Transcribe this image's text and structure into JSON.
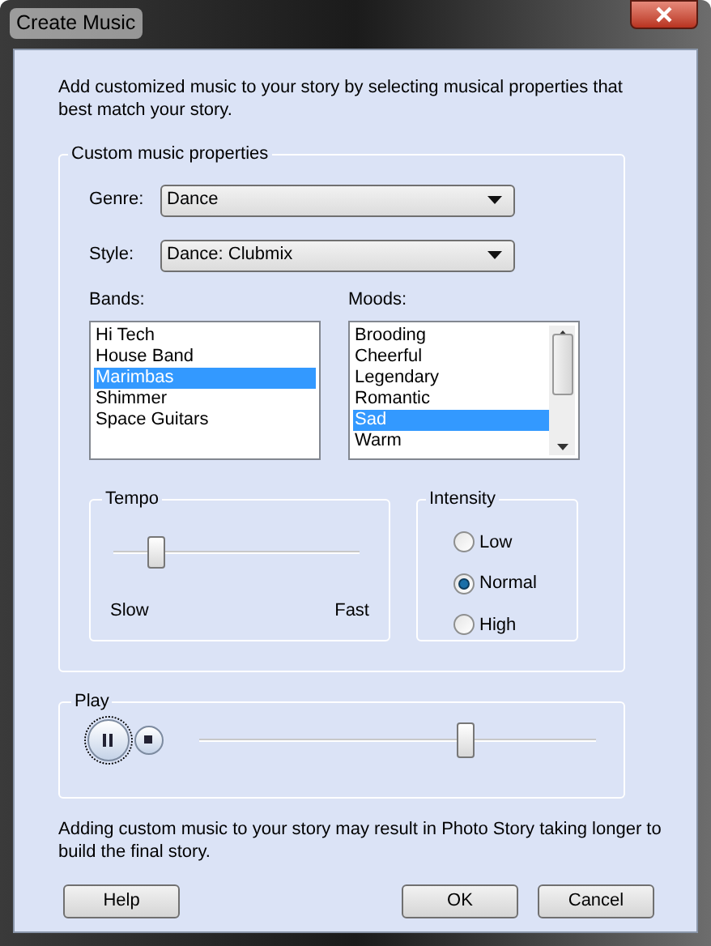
{
  "window": {
    "title": "Create Music"
  },
  "intro": "Add customized music to your story by selecting musical properties that best match your story.",
  "properties": {
    "title": "Custom music properties",
    "genre": {
      "label": "Genre:",
      "value": "Dance"
    },
    "style": {
      "label": "Style:",
      "value": "Dance: Clubmix"
    },
    "bands": {
      "label": "Bands:",
      "items": [
        {
          "label": "Hi Tech",
          "selected": false
        },
        {
          "label": "House Band",
          "selected": false
        },
        {
          "label": "Marimbas",
          "selected": true
        },
        {
          "label": "Shimmer",
          "selected": false
        },
        {
          "label": "Space Guitars",
          "selected": false
        }
      ]
    },
    "moods": {
      "label": "Moods:",
      "items": [
        {
          "label": "Brooding",
          "selected": false
        },
        {
          "label": "Cheerful",
          "selected": false
        },
        {
          "label": "Legendary",
          "selected": false
        },
        {
          "label": "Romantic",
          "selected": false
        },
        {
          "label": "Sad",
          "selected": true
        },
        {
          "label": "Warm",
          "selected": false
        }
      ]
    },
    "tempo": {
      "title": "Tempo",
      "level": 0.15,
      "min_label": "Slow",
      "max_label": "Fast"
    },
    "intensity": {
      "title": "Intensity",
      "options": [
        {
          "label": "Low",
          "selected": false
        },
        {
          "label": "Normal",
          "selected": true
        },
        {
          "label": "High",
          "selected": false
        }
      ]
    }
  },
  "play": {
    "title": "Play",
    "playing": true,
    "level": 0.68
  },
  "note": "Adding custom music to your story may result in Photo Story taking longer to build the final story.",
  "buttons": [
    {
      "label": "Help"
    },
    {
      "label": "OK"
    },
    {
      "label": "Cancel"
    }
  ]
}
